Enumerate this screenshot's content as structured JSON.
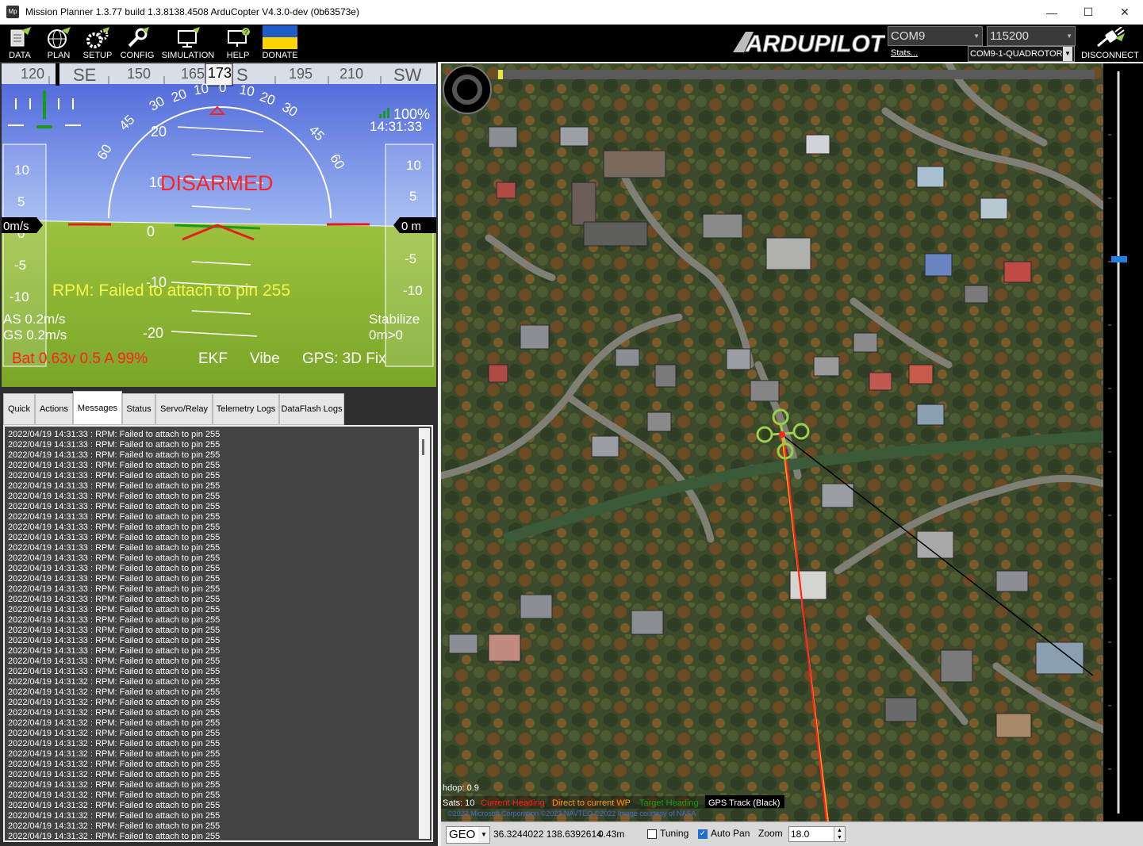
{
  "window": {
    "title": "Mission Planner 1.3.77 build 1.3.8138.4508 ArduCopter V4.3.0-dev (0b63573e)",
    "app_icon": "Mp",
    "controls": {
      "minimize": "—",
      "maximize": "☐",
      "close": "✕"
    }
  },
  "menu": {
    "items": [
      {
        "label": "DATA",
        "icon": "data-icon"
      },
      {
        "label": "PLAN",
        "icon": "globe-icon"
      },
      {
        "label": "SETUP",
        "icon": "gears-icon"
      },
      {
        "label": "CONFIG",
        "icon": "wrench-icon"
      },
      {
        "label": "SIMULATION",
        "icon": "monitor-icon"
      },
      {
        "label": "HELP",
        "icon": "help-icon"
      },
      {
        "label": "DONATE",
        "icon": "ukraine-flag-icon"
      }
    ],
    "logo": "ARDUPILOT",
    "port": "COM9",
    "baud": "115200",
    "stats_link": "Stats...",
    "profile": "COM9-1-QUADROTOR",
    "disconnect": "DISCONNECT"
  },
  "hud": {
    "heading_tape": [
      "120",
      "SE",
      "150",
      "165",
      "173",
      "S",
      "195",
      "210",
      "SW"
    ],
    "current_heading": "173",
    "pitch_labels": [
      "20",
      "10",
      "0",
      "-10",
      "-20"
    ],
    "roll_labels": [
      "60",
      "45",
      "30",
      "20",
      "10",
      "0",
      "10",
      "20",
      "30",
      "45",
      "60"
    ],
    "speed_scale": [
      "10",
      "5",
      "0",
      "-5",
      "-10"
    ],
    "alt_scale": [
      "10",
      "5",
      "0",
      "-5",
      "-10"
    ],
    "speed_readout": "0m/s",
    "alt_readout": "0 m",
    "status": "DISARMED",
    "message": "RPM: Failed to attach to pin 255",
    "link_quality": "100%",
    "time": "14:31:33",
    "airspeed": "AS 0.2m/s",
    "groundspeed": "GS 0.2m/s",
    "mode": "Stabilize",
    "wp_distance": "0m>0",
    "battery": "Bat 0.63v 0.5 A 99%",
    "ekf": "EKF",
    "vibe": "Vibe",
    "gps": "GPS: 3D Fix",
    "colors": {
      "sky": "#5a7ae0",
      "ground": "#8fb83a",
      "status": "#ff2020",
      "message": "#f5f54a"
    }
  },
  "tabs": [
    "Quick",
    "Actions",
    "Messages",
    "Status",
    "Servo/Relay",
    "Telemetry Logs",
    "DataFlash Logs"
  ],
  "active_tab": "Messages",
  "messages": [
    "2022/04/19 14:31:33 : RPM: Failed to attach to pin 255",
    "2022/04/19 14:31:33 : RPM: Failed to attach to pin 255",
    "2022/04/19 14:31:33 : RPM: Failed to attach to pin 255",
    "2022/04/19 14:31:33 : RPM: Failed to attach to pin 255",
    "2022/04/19 14:31:33 : RPM: Failed to attach to pin 255",
    "2022/04/19 14:31:33 : RPM: Failed to attach to pin 255",
    "2022/04/19 14:31:33 : RPM: Failed to attach to pin 255",
    "2022/04/19 14:31:33 : RPM: Failed to attach to pin 255",
    "2022/04/19 14:31:33 : RPM: Failed to attach to pin 255",
    "2022/04/19 14:31:33 : RPM: Failed to attach to pin 255",
    "2022/04/19 14:31:33 : RPM: Failed to attach to pin 255",
    "2022/04/19 14:31:33 : RPM: Failed to attach to pin 255",
    "2022/04/19 14:31:33 : RPM: Failed to attach to pin 255",
    "2022/04/19 14:31:33 : RPM: Failed to attach to pin 255",
    "2022/04/19 14:31:33 : RPM: Failed to attach to pin 255",
    "2022/04/19 14:31:33 : RPM: Failed to attach to pin 255",
    "2022/04/19 14:31:33 : RPM: Failed to attach to pin 255",
    "2022/04/19 14:31:33 : RPM: Failed to attach to pin 255",
    "2022/04/19 14:31:33 : RPM: Failed to attach to pin 255",
    "2022/04/19 14:31:33 : RPM: Failed to attach to pin 255",
    "2022/04/19 14:31:33 : RPM: Failed to attach to pin 255",
    "2022/04/19 14:31:33 : RPM: Failed to attach to pin 255",
    "2022/04/19 14:31:33 : RPM: Failed to attach to pin 255",
    "2022/04/19 14:31:33 : RPM: Failed to attach to pin 255",
    "2022/04/19 14:31:32 : RPM: Failed to attach to pin 255",
    "2022/04/19 14:31:32 : RPM: Failed to attach to pin 255",
    "2022/04/19 14:31:32 : RPM: Failed to attach to pin 255",
    "2022/04/19 14:31:32 : RPM: Failed to attach to pin 255",
    "2022/04/19 14:31:32 : RPM: Failed to attach to pin 255",
    "2022/04/19 14:31:32 : RPM: Failed to attach to pin 255",
    "2022/04/19 14:31:32 : RPM: Failed to attach to pin 255",
    "2022/04/19 14:31:32 : RPM: Failed to attach to pin 255",
    "2022/04/19 14:31:32 : RPM: Failed to attach to pin 255",
    "2022/04/19 14:31:32 : RPM: Failed to attach to pin 255",
    "2022/04/19 14:31:32 : RPM: Failed to attach to pin 255",
    "2022/04/19 14:31:32 : RPM: Failed to attach to pin 255",
    "2022/04/19 14:31:32 : RPM: Failed to attach to pin 255",
    "2022/04/19 14:31:32 : RPM: Failed to attach to pin 255",
    "2022/04/19 14:31:32 : RPM: Failed to attach to pin 255",
    "2022/04/19 14:31:32 : RPM: Failed to attach to pin 255"
  ],
  "map": {
    "hdop": "hdop: 0.9",
    "sats": "Sats: 10",
    "legend": [
      {
        "label": "Current Heading",
        "color": "#ff2020"
      },
      {
        "label": "Direct to current WP",
        "color": "#ff9a1a"
      },
      {
        "label": "Target Heading",
        "color": "#1a9a1a"
      },
      {
        "label": "GPS Track (Black)",
        "color": "#ffffff"
      }
    ],
    "copyright": "©2022 Microsoft Corporation ©2022 NAVTEQ ©2022 Image courtesy of NASA",
    "compass_value": "0",
    "coord_system": "GEO",
    "position": "36.3244022 138.6392614",
    "altitude": "0.43m",
    "tuning_label": "Tuning",
    "autopan_label": "Auto Pan",
    "zoom_label": "Zoom",
    "zoom_value": "18.0"
  }
}
